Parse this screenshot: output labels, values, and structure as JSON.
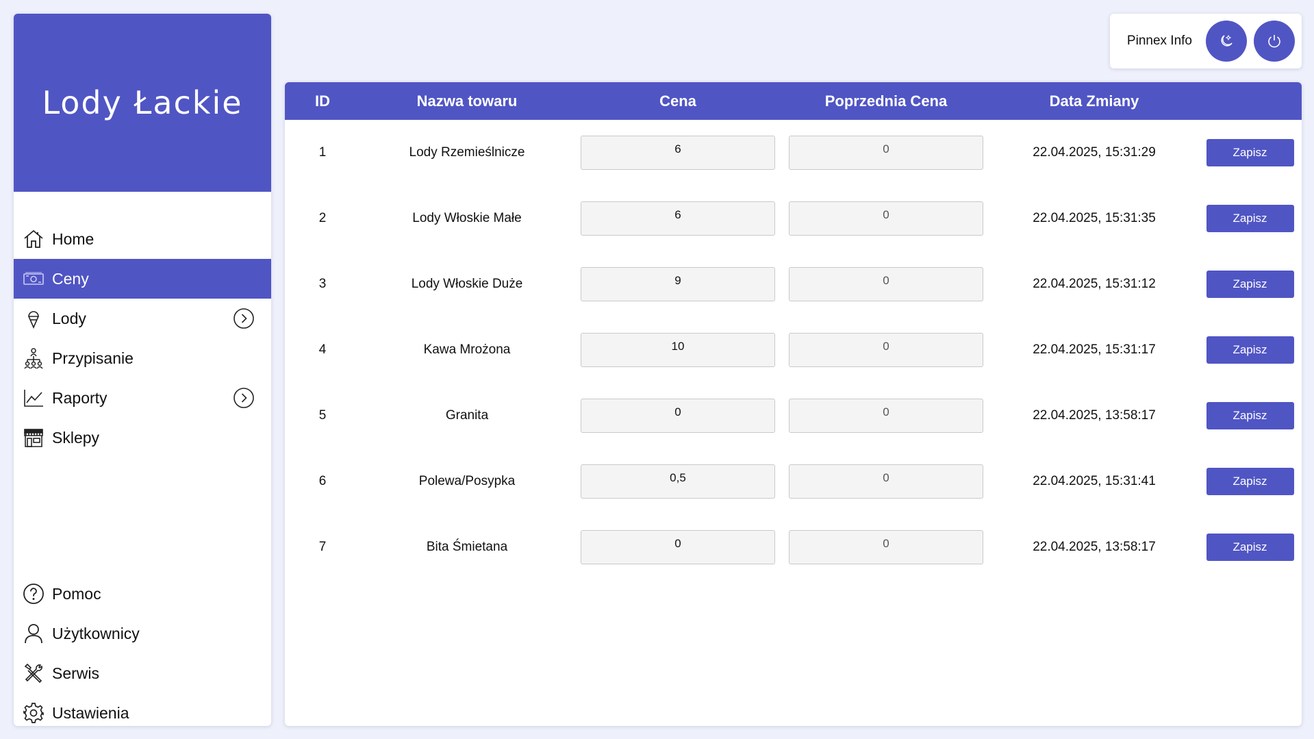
{
  "app": {
    "brand": "Lody Łackie"
  },
  "colors": {
    "accent": "#5055c4",
    "background": "#eef0fb"
  },
  "sidebar": {
    "top_items": [
      {
        "label": "Home",
        "icon": "home-icon",
        "active": false,
        "expandable": false
      },
      {
        "label": "Ceny",
        "icon": "banknote-icon",
        "active": true,
        "expandable": false
      },
      {
        "label": "Lody",
        "icon": "ice-cream-icon",
        "active": false,
        "expandable": true
      },
      {
        "label": "Przypisanie",
        "icon": "hierarchy-icon",
        "active": false,
        "expandable": false
      },
      {
        "label": "Raporty",
        "icon": "line-chart-icon",
        "active": false,
        "expandable": true
      },
      {
        "label": "Sklepy",
        "icon": "store-icon",
        "active": false,
        "expandable": false
      }
    ],
    "bottom_items": [
      {
        "label": "Pomoc",
        "icon": "help-icon"
      },
      {
        "label": "Użytkownicy",
        "icon": "user-icon"
      },
      {
        "label": "Serwis",
        "icon": "tools-icon"
      },
      {
        "label": "Ustawienia",
        "icon": "gear-icon"
      }
    ]
  },
  "header": {
    "username": "Pinnex Info",
    "theme_button_icon": "moon-icon",
    "logout_button_icon": "power-icon"
  },
  "table": {
    "columns": [
      "ID",
      "Nazwa towaru",
      "Cena",
      "Poprzednia Cena",
      "Data Zmiany"
    ],
    "save_label": "Zapisz",
    "rows": [
      {
        "id": "1",
        "name": "Lody Rzemieślnicze",
        "price": "6",
        "prev_price": "0",
        "date": "22.04.2025, 15:31:29"
      },
      {
        "id": "2",
        "name": "Lody Włoskie Małe",
        "price": "6",
        "prev_price": "0",
        "date": "22.04.2025, 15:31:35"
      },
      {
        "id": "3",
        "name": "Lody Włoskie Duże",
        "price": "9",
        "prev_price": "0",
        "date": "22.04.2025, 15:31:12"
      },
      {
        "id": "4",
        "name": "Kawa Mrożona",
        "price": "10",
        "prev_price": "0",
        "date": "22.04.2025, 15:31:17"
      },
      {
        "id": "5",
        "name": "Granita",
        "price": "0",
        "prev_price": "0",
        "date": "22.04.2025, 13:58:17"
      },
      {
        "id": "6",
        "name": "Polewa/Posypka",
        "price": "0,5",
        "prev_price": "0",
        "date": "22.04.2025, 15:31:41"
      },
      {
        "id": "7",
        "name": "Bita Śmietana",
        "price": "0",
        "prev_price": "0",
        "date": "22.04.2025, 13:58:17"
      }
    ]
  }
}
